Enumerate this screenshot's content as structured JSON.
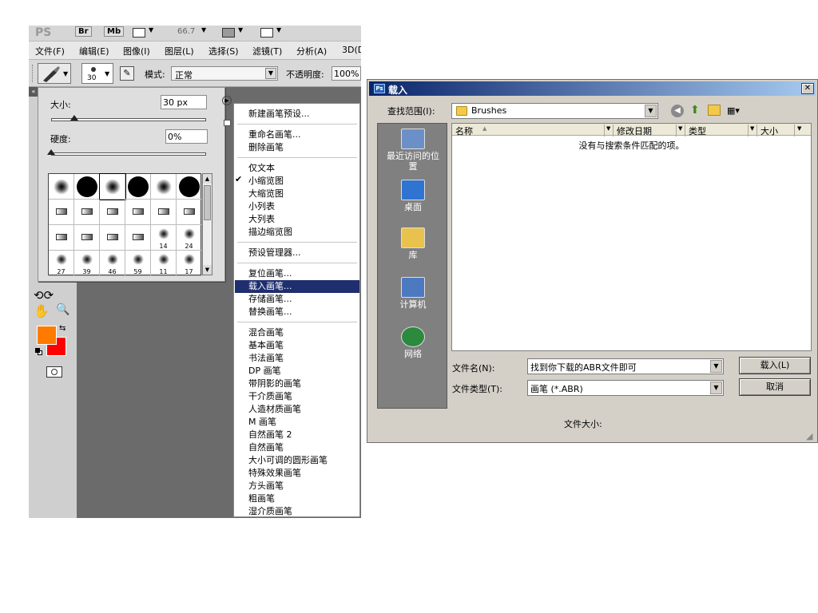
{
  "ps": {
    "logo": "PS",
    "bridge_label": "Br",
    "minibridge_label": "Mb",
    "zoom": "66.7",
    "menu": [
      "文件(F)",
      "编辑(E)",
      "图像(I)",
      "图层(L)",
      "选择(S)",
      "滤镜(T)",
      "分析(A)",
      "3D(D"
    ],
    "options": {
      "brush_size_badge": "30",
      "mode_label": "模式:",
      "mode_value": "正常",
      "opacity_label": "不透明度:",
      "opacity_value": "100%"
    },
    "brush_panel": {
      "size_label": "大小:",
      "size_value": "30 px",
      "size_fraction": 0.15,
      "hardness_label": "硬度:",
      "hardness_value": "0%",
      "hardness_fraction": 0.0,
      "brushes": [
        {
          "type": "soft"
        },
        {
          "type": "hard"
        },
        {
          "type": "soft"
        },
        {
          "type": "hard"
        },
        {
          "type": "soft"
        },
        {
          "type": "hard"
        },
        {
          "type": "shape"
        },
        {
          "type": "shape"
        },
        {
          "type": "shape"
        },
        {
          "type": "shape"
        },
        {
          "type": "shape"
        },
        {
          "type": "shape"
        },
        {
          "type": "shape"
        },
        {
          "type": "shape"
        },
        {
          "type": "shape"
        },
        {
          "type": "shape"
        },
        {
          "type": "scatter",
          "num": "14"
        },
        {
          "type": "scatter",
          "num": "24"
        },
        {
          "type": "scatter",
          "num": "27"
        },
        {
          "type": "scatter",
          "num": "39"
        },
        {
          "type": "scatter",
          "num": "46"
        },
        {
          "type": "scatter",
          "num": "59"
        },
        {
          "type": "scatter",
          "num": "11"
        },
        {
          "type": "scatter",
          "num": "17"
        }
      ]
    },
    "foreground_color": "#ff7b00",
    "background_color": "#ff0000"
  },
  "context_menu": {
    "groups": [
      [
        {
          "label": "新建画笔预设..."
        }
      ],
      [
        {
          "label": "重命名画笔..."
        },
        {
          "label": "删除画笔"
        }
      ],
      [
        {
          "label": "仅文本"
        },
        {
          "label": "小缩览图",
          "checked": true
        },
        {
          "label": "大缩览图"
        },
        {
          "label": "小列表"
        },
        {
          "label": "大列表"
        },
        {
          "label": "描边缩览图"
        }
      ],
      [
        {
          "label": "预设管理器..."
        }
      ],
      [
        {
          "label": "复位画笔..."
        },
        {
          "label": "载入画笔...",
          "highlighted": true
        },
        {
          "label": "存储画笔..."
        },
        {
          "label": "替换画笔..."
        }
      ],
      [
        {
          "label": "混合画笔"
        },
        {
          "label": "基本画笔"
        },
        {
          "label": "书法画笔"
        },
        {
          "label": "DP 画笔"
        },
        {
          "label": "带阴影的画笔"
        },
        {
          "label": "干介质画笔"
        },
        {
          "label": "人造材质画笔"
        },
        {
          "label": "M 画笔"
        },
        {
          "label": "自然画笔 2"
        },
        {
          "label": "自然画笔"
        },
        {
          "label": "大小可调的圆形画笔"
        },
        {
          "label": "特殊效果画笔"
        },
        {
          "label": "方头画笔"
        },
        {
          "label": "粗画笔"
        },
        {
          "label": "湿介质画笔"
        }
      ]
    ]
  },
  "dialog": {
    "ps_badge": "Ps",
    "title": "载入",
    "close_glyph": "✕",
    "lookin_label": "查找范围(I):",
    "lookin_value": "Brushes",
    "columns": [
      "名称",
      "修改日期",
      "类型",
      "大小"
    ],
    "empty_message": "没有与搜索条件匹配的项。",
    "places": [
      {
        "label": "最近访问的位置",
        "icon": "recent-places-icon"
      },
      {
        "label": "桌面",
        "icon": "desktop-icon"
      },
      {
        "label": "库",
        "icon": "libraries-icon"
      },
      {
        "label": "计算机",
        "icon": "computer-icon"
      },
      {
        "label": "网络",
        "icon": "network-icon"
      }
    ],
    "filename_label": "文件名(N):",
    "filename_value": "找到你下载的ABR文件即可",
    "filetype_label": "文件类型(T):",
    "filetype_value": "画笔 (*.ABR)",
    "load_button": "载入(L)",
    "cancel_button": "取消",
    "filesize_label": "文件大小:"
  }
}
